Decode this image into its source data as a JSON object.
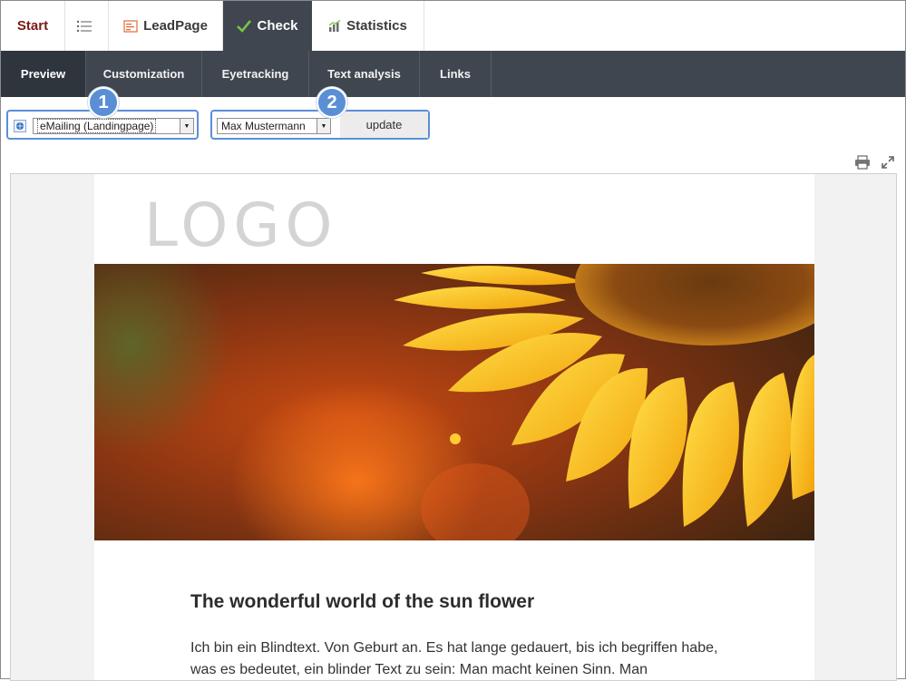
{
  "tabs": {
    "start": "Start",
    "list_icon": "list-icon",
    "leadpage": "LeadPage",
    "check": "Check",
    "statistics": "Statistics"
  },
  "subnav": {
    "items": [
      "Preview",
      "Customization",
      "Eyetracking",
      "Text analysis",
      "Links"
    ],
    "active": "Preview"
  },
  "controls": {
    "mailing_select": "eMailing (Landingpage)",
    "recipient_select": "Max Mustermann",
    "update_label": "update",
    "badge1": "1",
    "badge2": "2"
  },
  "preview": {
    "logo": "LOGO",
    "title": "The wonderful world of the sun flower",
    "body": "Ich bin ein Blindtext. Von Geburt an. Es hat lange gedauert, bis ich begriffen habe, was es bedeutet, ein blinder Text zu sein: Man macht keinen Sinn. Man"
  },
  "colors": {
    "accent_blue": "#5a8fd6",
    "nav_dark": "#3f4650",
    "start_red": "#7a1a14"
  }
}
